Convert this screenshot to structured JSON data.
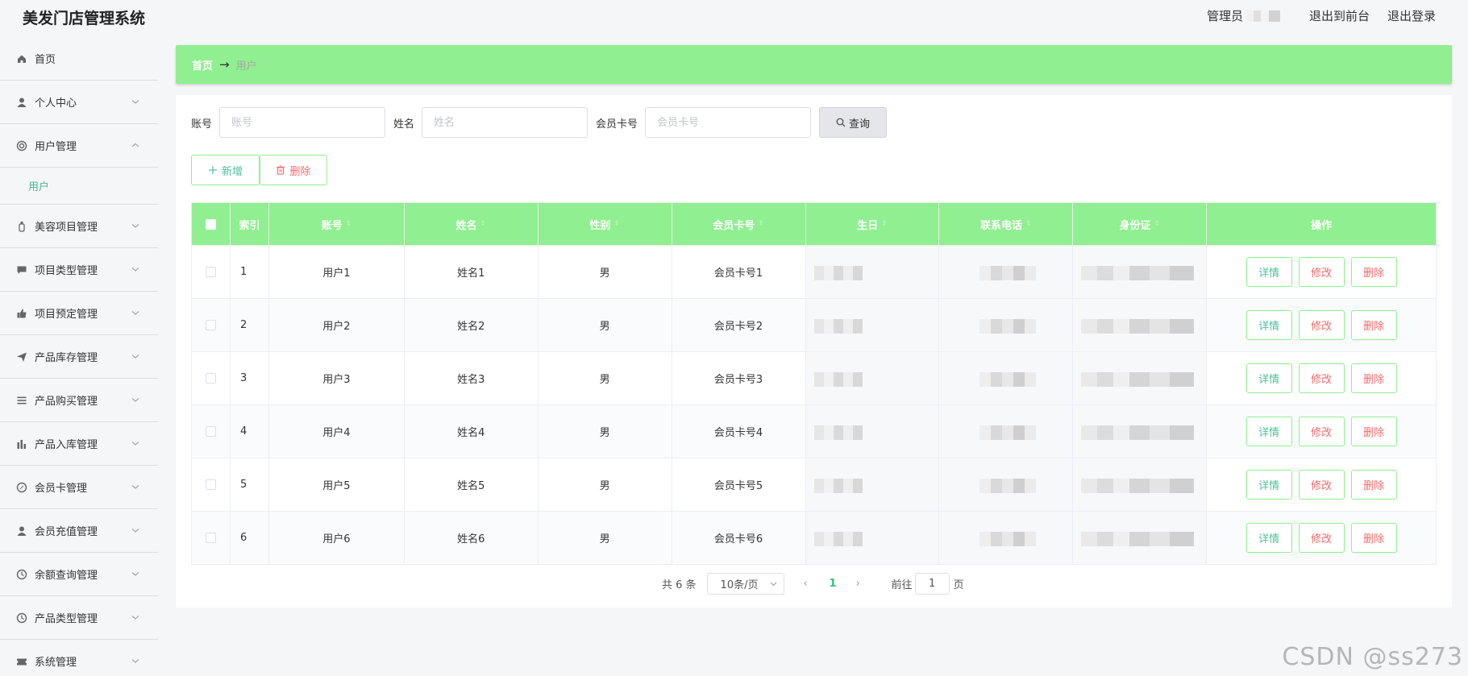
{
  "app": {
    "title": "美发门店管理系统",
    "admin_label": "管理员",
    "front_link": "退出到前台",
    "logout_link": "退出登录"
  },
  "sidebar": {
    "items": [
      {
        "label": "首页",
        "icon": "home-icon"
      },
      {
        "label": "个人中心",
        "icon": "user-icon"
      },
      {
        "label": "用户管理",
        "icon": "lifebuoy-icon",
        "expanded": true,
        "children": [
          "用户"
        ]
      },
      {
        "label": "美容项目管理",
        "icon": "bottle-icon"
      },
      {
        "label": "项目类型管理",
        "icon": "chat-icon"
      },
      {
        "label": "项目预定管理",
        "icon": "thumb-icon"
      },
      {
        "label": "产品库存管理",
        "icon": "send-icon"
      },
      {
        "label": "产品购买管理",
        "icon": "list-icon"
      },
      {
        "label": "产品入库管理",
        "icon": "chart-icon"
      },
      {
        "label": "会员卡管理",
        "icon": "compass-icon"
      },
      {
        "label": "会员充值管理",
        "icon": "user-icon"
      },
      {
        "label": "余额查询管理",
        "icon": "clock-icon"
      },
      {
        "label": "产品类型管理",
        "icon": "clock-icon"
      },
      {
        "label": "系统管理",
        "icon": "ticket-icon"
      }
    ]
  },
  "breadcrumb": {
    "home": "首页",
    "separator": "→",
    "current": "用户"
  },
  "search": {
    "account_label": "账号",
    "account_placeholder": "账号",
    "name_label": "姓名",
    "name_placeholder": "姓名",
    "card_label": "会员卡号",
    "card_placeholder": "会员卡号",
    "query_label": "查询"
  },
  "actions": {
    "add_label": "新增",
    "delete_label": "删除"
  },
  "table": {
    "headers": {
      "index": "索引",
      "account": "账号",
      "name": "姓名",
      "gender": "性别",
      "card": "会员卡号",
      "birthday": "生日",
      "phone": "联系电话",
      "idcard": "身份证",
      "ops": "操作"
    },
    "rows": [
      {
        "index": "1",
        "account": "用户1",
        "name": "姓名1",
        "gender": "男",
        "card": "会员卡号1"
      },
      {
        "index": "2",
        "account": "用户2",
        "name": "姓名2",
        "gender": "男",
        "card": "会员卡号2"
      },
      {
        "index": "3",
        "account": "用户3",
        "name": "姓名3",
        "gender": "男",
        "card": "会员卡号3"
      },
      {
        "index": "4",
        "account": "用户4",
        "name": "姓名4",
        "gender": "男",
        "card": "会员卡号4"
      },
      {
        "index": "5",
        "account": "用户5",
        "name": "姓名5",
        "gender": "男",
        "card": "会员卡号5"
      },
      {
        "index": "6",
        "account": "用户6",
        "name": "姓名6",
        "gender": "男",
        "card": "会员卡号6"
      }
    ],
    "op_labels": {
      "detail": "详情",
      "edit": "修改",
      "remove": "删除"
    }
  },
  "pagination": {
    "total": "共 6 条",
    "page_size": "10条/页",
    "current_page": "1",
    "goto_label": "前往",
    "goto_value": "1",
    "page_suffix": "页"
  },
  "watermark": "CSDN @ss273",
  "colors": {
    "accent_green": "#90ef90",
    "link_teal": "#4ec09a",
    "danger": "#f56c6c"
  }
}
